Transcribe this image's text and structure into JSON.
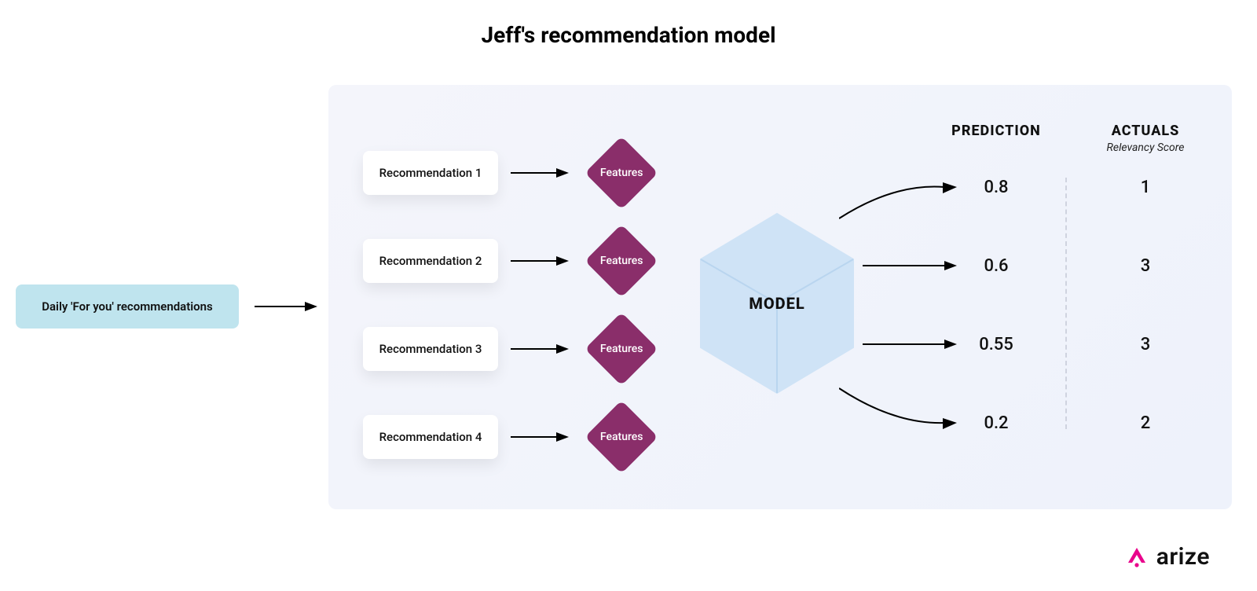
{
  "title": "Jeff's recommendation model",
  "input_label": "Daily 'For you' recommendations",
  "recommendations": [
    {
      "label": "Recommendation 1",
      "feature_label": "Features"
    },
    {
      "label": "Recommendation 2",
      "feature_label": "Features"
    },
    {
      "label": "Recommendation 3",
      "feature_label": "Features"
    },
    {
      "label": "Recommendation 4",
      "feature_label": "Features"
    }
  ],
  "model_label": "MODEL",
  "columns": {
    "prediction_header": "PREDICTION",
    "actuals_header": "ACTUALS",
    "actuals_subheader": "Relevancy Score"
  },
  "rows": [
    {
      "prediction": "0.8",
      "actual": "1"
    },
    {
      "prediction": "0.6",
      "actual": "3"
    },
    {
      "prediction": "0.55",
      "actual": "3"
    },
    {
      "prediction": "0.2",
      "actual": "2"
    }
  ],
  "brand": "arize",
  "colors": {
    "pill_bg": "#bfe4ee",
    "diamond_bg": "#8a2e6a",
    "model_fill": "#cfe3f6",
    "brand_accent": "#e9048c"
  }
}
